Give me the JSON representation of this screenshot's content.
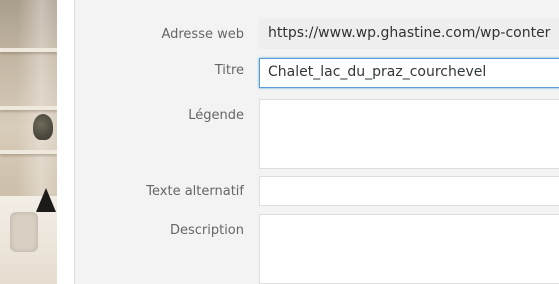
{
  "attachment_details": {
    "url": {
      "label": "Adresse web",
      "value": "https://www.wp.ghastine.com/wp-conter"
    },
    "title": {
      "label": "Titre",
      "value": "Chalet_lac_du_praz_courchevel"
    },
    "caption": {
      "label": "Légende",
      "value": ""
    },
    "alt_text": {
      "label": "Texte alternatif",
      "value": ""
    },
    "description": {
      "label": "Description",
      "value": ""
    }
  },
  "colors": {
    "panel_bg": "#f3f3f3",
    "field_bg": "#ffffff",
    "readonly_bg": "#eeeeee",
    "focus_border": "#5b9dd9",
    "label_text": "#666666"
  }
}
